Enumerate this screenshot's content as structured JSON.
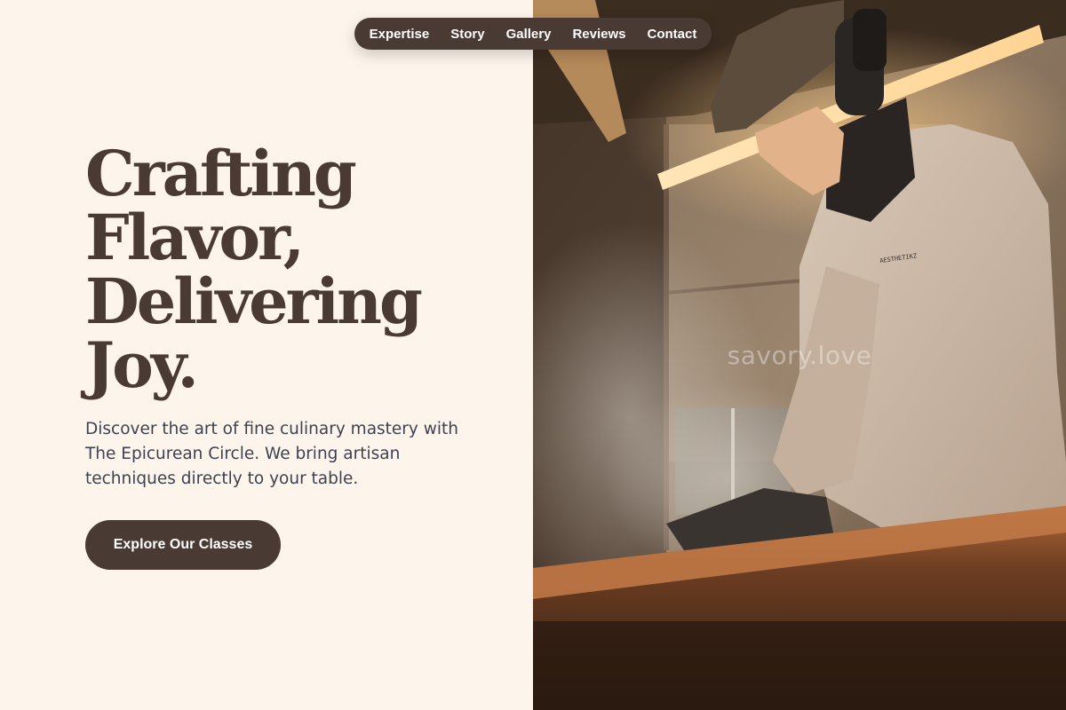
{
  "nav": {
    "links": [
      "Expertise",
      "Story",
      "Gallery",
      "Reviews",
      "Contact"
    ]
  },
  "hero": {
    "title_lines": [
      "Crafting",
      "Flavor,",
      "Delivering",
      "Joy."
    ],
    "description": "Discover the art of fine culinary mastery with The Epicurean Circle. We bring artisan techniques directly to your table.",
    "cta_label": "Explore Our Classes"
  },
  "photo": {
    "watermark": "savory.love",
    "sweatshirt_text": "AESTHETIKZ"
  },
  "colors": {
    "background": "#fdf5ec",
    "primary": "#4a3a34",
    "body_text": "#3c4252"
  }
}
